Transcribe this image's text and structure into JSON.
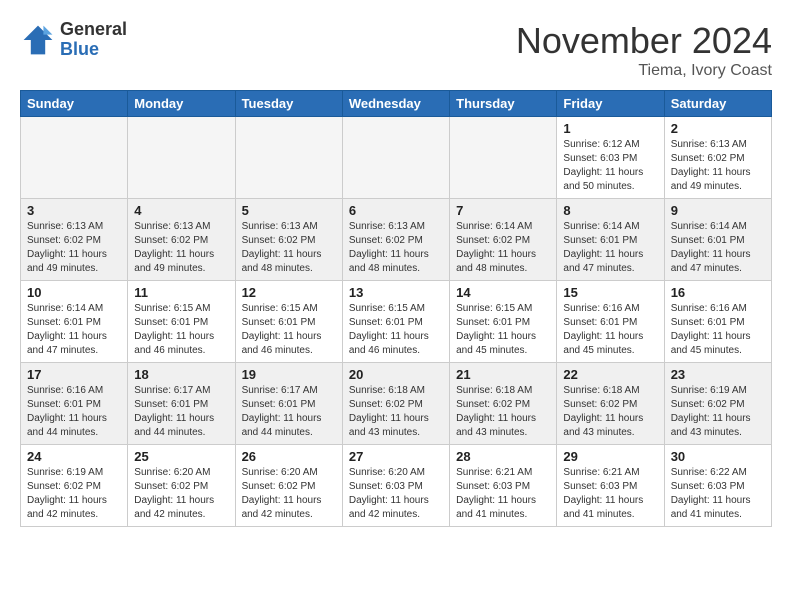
{
  "header": {
    "logo_general": "General",
    "logo_blue": "Blue",
    "month_title": "November 2024",
    "location": "Tiema, Ivory Coast"
  },
  "weekdays": [
    "Sunday",
    "Monday",
    "Tuesday",
    "Wednesday",
    "Thursday",
    "Friday",
    "Saturday"
  ],
  "weeks": [
    [
      {
        "day": "",
        "empty": true
      },
      {
        "day": "",
        "empty": true
      },
      {
        "day": "",
        "empty": true
      },
      {
        "day": "",
        "empty": true
      },
      {
        "day": "",
        "empty": true
      },
      {
        "day": "1",
        "sunrise": "Sunrise: 6:12 AM",
        "sunset": "Sunset: 6:03 PM",
        "daylight": "Daylight: 11 hours and 50 minutes."
      },
      {
        "day": "2",
        "sunrise": "Sunrise: 6:13 AM",
        "sunset": "Sunset: 6:02 PM",
        "daylight": "Daylight: 11 hours and 49 minutes."
      }
    ],
    [
      {
        "day": "3",
        "sunrise": "Sunrise: 6:13 AM",
        "sunset": "Sunset: 6:02 PM",
        "daylight": "Daylight: 11 hours and 49 minutes."
      },
      {
        "day": "4",
        "sunrise": "Sunrise: 6:13 AM",
        "sunset": "Sunset: 6:02 PM",
        "daylight": "Daylight: 11 hours and 49 minutes."
      },
      {
        "day": "5",
        "sunrise": "Sunrise: 6:13 AM",
        "sunset": "Sunset: 6:02 PM",
        "daylight": "Daylight: 11 hours and 48 minutes."
      },
      {
        "day": "6",
        "sunrise": "Sunrise: 6:13 AM",
        "sunset": "Sunset: 6:02 PM",
        "daylight": "Daylight: 11 hours and 48 minutes."
      },
      {
        "day": "7",
        "sunrise": "Sunrise: 6:14 AM",
        "sunset": "Sunset: 6:02 PM",
        "daylight": "Daylight: 11 hours and 48 minutes."
      },
      {
        "day": "8",
        "sunrise": "Sunrise: 6:14 AM",
        "sunset": "Sunset: 6:01 PM",
        "daylight": "Daylight: 11 hours and 47 minutes."
      },
      {
        "day": "9",
        "sunrise": "Sunrise: 6:14 AM",
        "sunset": "Sunset: 6:01 PM",
        "daylight": "Daylight: 11 hours and 47 minutes."
      }
    ],
    [
      {
        "day": "10",
        "sunrise": "Sunrise: 6:14 AM",
        "sunset": "Sunset: 6:01 PM",
        "daylight": "Daylight: 11 hours and 47 minutes."
      },
      {
        "day": "11",
        "sunrise": "Sunrise: 6:15 AM",
        "sunset": "Sunset: 6:01 PM",
        "daylight": "Daylight: 11 hours and 46 minutes."
      },
      {
        "day": "12",
        "sunrise": "Sunrise: 6:15 AM",
        "sunset": "Sunset: 6:01 PM",
        "daylight": "Daylight: 11 hours and 46 minutes."
      },
      {
        "day": "13",
        "sunrise": "Sunrise: 6:15 AM",
        "sunset": "Sunset: 6:01 PM",
        "daylight": "Daylight: 11 hours and 46 minutes."
      },
      {
        "day": "14",
        "sunrise": "Sunrise: 6:15 AM",
        "sunset": "Sunset: 6:01 PM",
        "daylight": "Daylight: 11 hours and 45 minutes."
      },
      {
        "day": "15",
        "sunrise": "Sunrise: 6:16 AM",
        "sunset": "Sunset: 6:01 PM",
        "daylight": "Daylight: 11 hours and 45 minutes."
      },
      {
        "day": "16",
        "sunrise": "Sunrise: 6:16 AM",
        "sunset": "Sunset: 6:01 PM",
        "daylight": "Daylight: 11 hours and 45 minutes."
      }
    ],
    [
      {
        "day": "17",
        "sunrise": "Sunrise: 6:16 AM",
        "sunset": "Sunset: 6:01 PM",
        "daylight": "Daylight: 11 hours and 44 minutes."
      },
      {
        "day": "18",
        "sunrise": "Sunrise: 6:17 AM",
        "sunset": "Sunset: 6:01 PM",
        "daylight": "Daylight: 11 hours and 44 minutes."
      },
      {
        "day": "19",
        "sunrise": "Sunrise: 6:17 AM",
        "sunset": "Sunset: 6:01 PM",
        "daylight": "Daylight: 11 hours and 44 minutes."
      },
      {
        "day": "20",
        "sunrise": "Sunrise: 6:18 AM",
        "sunset": "Sunset: 6:02 PM",
        "daylight": "Daylight: 11 hours and 43 minutes."
      },
      {
        "day": "21",
        "sunrise": "Sunrise: 6:18 AM",
        "sunset": "Sunset: 6:02 PM",
        "daylight": "Daylight: 11 hours and 43 minutes."
      },
      {
        "day": "22",
        "sunrise": "Sunrise: 6:18 AM",
        "sunset": "Sunset: 6:02 PM",
        "daylight": "Daylight: 11 hours and 43 minutes."
      },
      {
        "day": "23",
        "sunrise": "Sunrise: 6:19 AM",
        "sunset": "Sunset: 6:02 PM",
        "daylight": "Daylight: 11 hours and 43 minutes."
      }
    ],
    [
      {
        "day": "24",
        "sunrise": "Sunrise: 6:19 AM",
        "sunset": "Sunset: 6:02 PM",
        "daylight": "Daylight: 11 hours and 42 minutes."
      },
      {
        "day": "25",
        "sunrise": "Sunrise: 6:20 AM",
        "sunset": "Sunset: 6:02 PM",
        "daylight": "Daylight: 11 hours and 42 minutes."
      },
      {
        "day": "26",
        "sunrise": "Sunrise: 6:20 AM",
        "sunset": "Sunset: 6:02 PM",
        "daylight": "Daylight: 11 hours and 42 minutes."
      },
      {
        "day": "27",
        "sunrise": "Sunrise: 6:20 AM",
        "sunset": "Sunset: 6:03 PM",
        "daylight": "Daylight: 11 hours and 42 minutes."
      },
      {
        "day": "28",
        "sunrise": "Sunrise: 6:21 AM",
        "sunset": "Sunset: 6:03 PM",
        "daylight": "Daylight: 11 hours and 41 minutes."
      },
      {
        "day": "29",
        "sunrise": "Sunrise: 6:21 AM",
        "sunset": "Sunset: 6:03 PM",
        "daylight": "Daylight: 11 hours and 41 minutes."
      },
      {
        "day": "30",
        "sunrise": "Sunrise: 6:22 AM",
        "sunset": "Sunset: 6:03 PM",
        "daylight": "Daylight: 11 hours and 41 minutes."
      }
    ]
  ]
}
